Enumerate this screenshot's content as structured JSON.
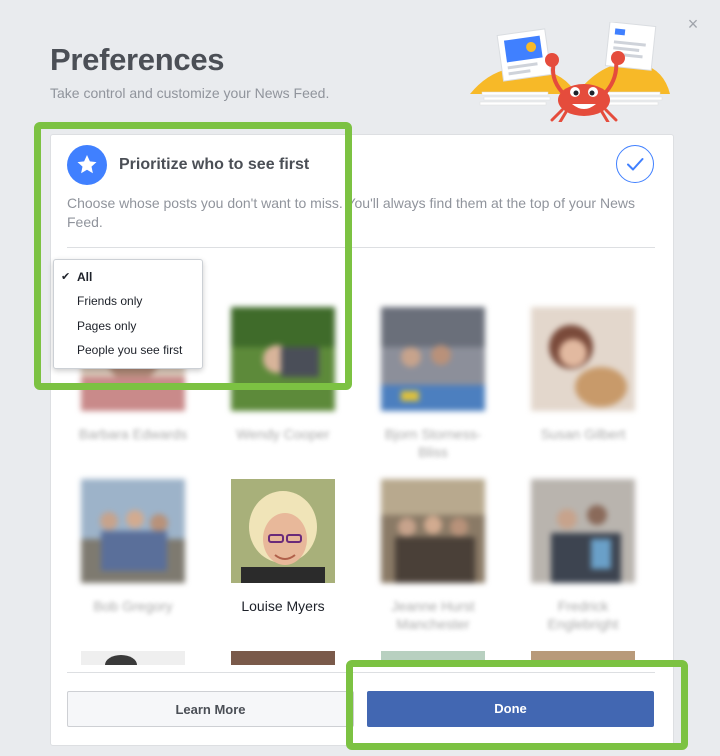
{
  "header": {
    "title": "Preferences",
    "subtitle": "Take control and customize your News Feed."
  },
  "close_icon": "×",
  "prioritize": {
    "title": "Prioritize who to see first",
    "description": "Choose whose posts you don't want to miss. You'll always find them at the top of your News Feed.",
    "icon": "star-icon",
    "selected_icon": "checkmark-icon"
  },
  "filter_menu": {
    "options": [
      {
        "label": "All",
        "selected": true
      },
      {
        "label": "Friends only",
        "selected": false
      },
      {
        "label": "Pages only",
        "selected": false
      },
      {
        "label": "People you see first",
        "selected": false
      }
    ],
    "check_mark": "✔"
  },
  "people": [
    {
      "name": "Barbara Edwards"
    },
    {
      "name": "Wendy Cooper"
    },
    {
      "name": "Bjorn Storness-Bliss"
    },
    {
      "name": "Susan Gilbert"
    },
    {
      "name": "Bob Gregory"
    },
    {
      "name": "Louise Myers"
    },
    {
      "name": "Jeanne Hurst Manchester"
    },
    {
      "name": "Fredrick Englebright"
    }
  ],
  "footer": {
    "learn_more": "Learn More",
    "done": "Done"
  },
  "colors": {
    "accent_blue": "#4080ff",
    "done_blue": "#4267b2",
    "highlight_green": "#7cc242",
    "background": "#e9ebee"
  }
}
